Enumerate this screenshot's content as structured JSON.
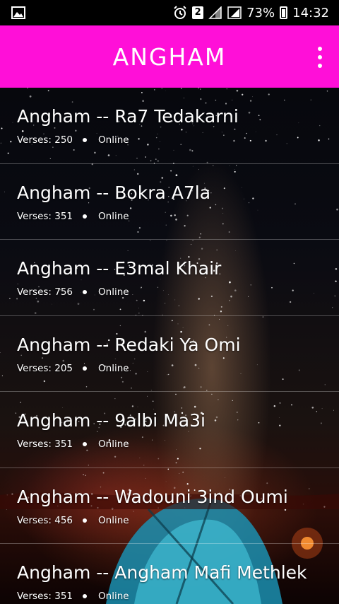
{
  "status_bar": {
    "image_icon": "image-icon",
    "alarm_icon": "alarm-icon",
    "sim_number": "2",
    "battery_percent": "73%",
    "time": "14:32"
  },
  "app_bar": {
    "title": "ANGHAM",
    "menu_icon": "more-vert-icon",
    "color": "#ff0fd8"
  },
  "songs": [
    {
      "title": "Angham -- Ra7 Tedakarni",
      "verses": "Verses: 250",
      "status": "Online"
    },
    {
      "title": "Angham -- Bokra A7la",
      "verses": "Verses: 351",
      "status": "Online"
    },
    {
      "title": "Angham -- E3mal Khair",
      "verses": "Verses: 756",
      "status": "Online"
    },
    {
      "title": "Angham -- Redaki Ya Omi",
      "verses": "Verses: 205",
      "status": "Online"
    },
    {
      "title": "Angham -- 9albi Ma3i",
      "verses": "Verses: 351",
      "status": "Online"
    },
    {
      "title": "Angham -- Wadouni 3ind Oumi",
      "verses": "Verses: 456",
      "status": "Online"
    },
    {
      "title": "Angham -- Angham Mafi Methlek",
      "verses": "Verses: 351",
      "status": "Online"
    }
  ]
}
